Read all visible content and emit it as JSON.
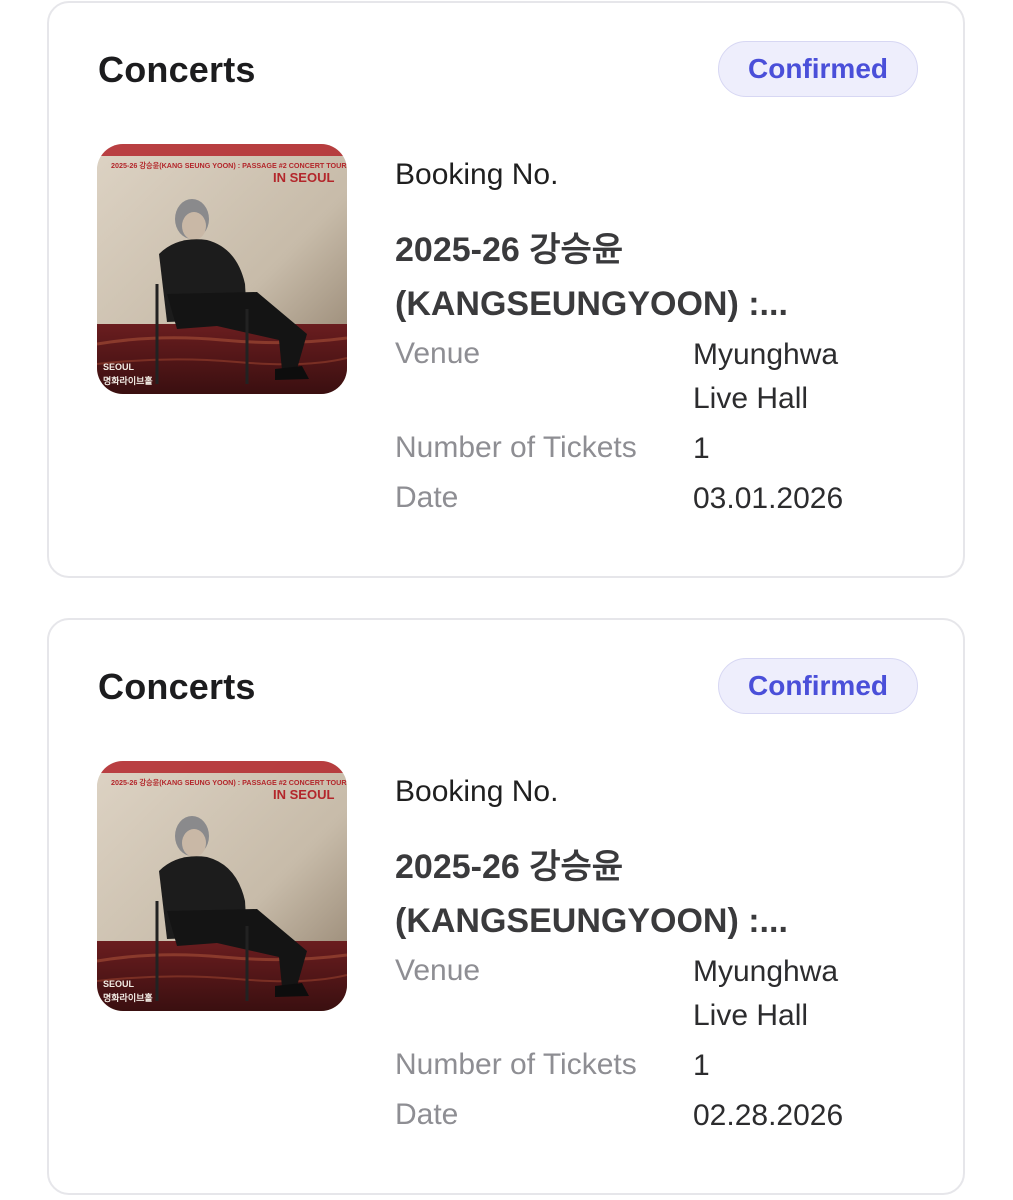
{
  "bookings": [
    {
      "category": "Concerts",
      "status": "Confirmed",
      "booking_label": "Booking No.",
      "title_line1": "2025-26 강승윤",
      "title_line2": "(KANGSEUNGYOON) :...",
      "venue_label": "Venue",
      "venue_value_line1": "Myunghwa",
      "venue_value_line2": "Live Hall",
      "tickets_label": "Number of Tickets",
      "tickets_value": "1",
      "date_label": "Date",
      "date_value": "03.01.2026",
      "poster": {
        "header": "2025-26 강승윤(KANG SEUNG YOON) : PASSAGE #2 CONCERT TOUR",
        "city_banner": "IN SEOUL",
        "city": "SEOUL",
        "venue_kr": "명화라이브홀"
      }
    },
    {
      "category": "Concerts",
      "status": "Confirmed",
      "booking_label": "Booking No.",
      "title_line1": "2025-26 강승윤",
      "title_line2": "(KANGSEUNGYOON) :...",
      "venue_label": "Venue",
      "venue_value_line1": "Myunghwa",
      "venue_value_line2": "Live Hall",
      "tickets_label": "Number of Tickets",
      "tickets_value": "1",
      "date_label": "Date",
      "date_value": "02.28.2026",
      "poster": {
        "header": "2025-26 강승윤(KANG SEUNG YOON) : PASSAGE #2 CONCERT TOUR",
        "city_banner": "IN SEOUL",
        "city": "SEOUL",
        "venue_kr": "명화라이브홀"
      }
    }
  ],
  "colors": {
    "badge_text": "#4a4fd9",
    "badge_bg": "#eeeefc",
    "card_border": "#e6e6ea",
    "label_gray": "#8e8e93",
    "poster_red": "#b3262b"
  }
}
